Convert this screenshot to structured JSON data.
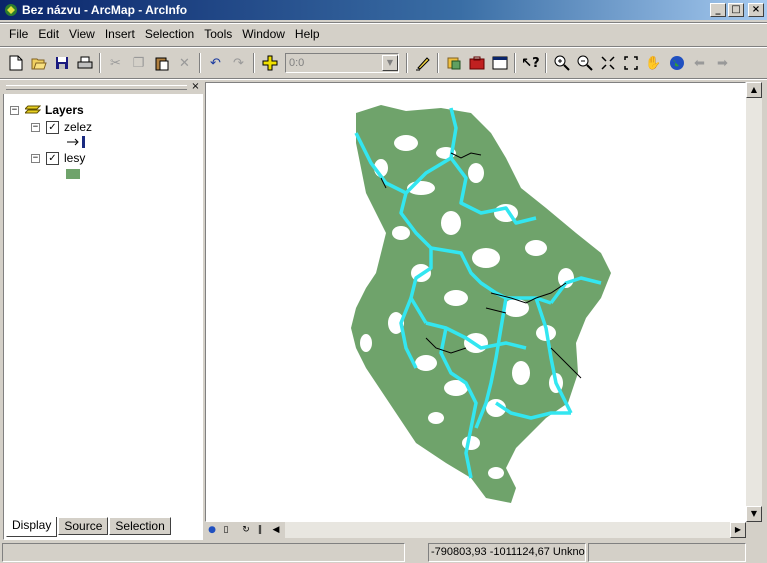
{
  "window": {
    "title": "Bez názvu - ArcMap - ArcInfo",
    "controls": {
      "minimize": "_",
      "maximize": "□",
      "close": "×"
    }
  },
  "menu": [
    {
      "label": "File",
      "key": "F"
    },
    {
      "label": "Edit",
      "key": "E"
    },
    {
      "label": "View",
      "key": "V"
    },
    {
      "label": "Insert",
      "key": "I"
    },
    {
      "label": "Selection",
      "key": "S"
    },
    {
      "label": "Tools",
      "key": "T"
    },
    {
      "label": "Window",
      "key": "W"
    },
    {
      "label": "Help",
      "key": "H"
    }
  ],
  "toolbar": {
    "scale_value": "0:0",
    "icons": [
      "new-icon",
      "open-icon",
      "save-icon",
      "print-icon",
      "cut-icon",
      "copy-icon",
      "paste-icon",
      "delete-icon",
      "undo-icon",
      "redo-icon",
      "add-data-icon",
      "scale-combo",
      "editor-icon",
      "arccatalog-icon",
      "arctoolbox-icon",
      "command-line-icon",
      "whats-this-icon",
      "zoom-in-icon",
      "zoom-out-icon",
      "fixed-zoom-in-icon",
      "fixed-zoom-out-icon",
      "pan-icon",
      "full-extent-icon",
      "back-icon",
      "forward-icon"
    ]
  },
  "toc": {
    "root_label": "Layers",
    "layers": [
      {
        "name": "zelez",
        "checked": true,
        "symbol": "line"
      },
      {
        "name": "lesy",
        "checked": true,
        "symbol": "polygon",
        "color": "#6fa36b"
      }
    ],
    "tabs": [
      "Display",
      "Source",
      "Selection"
    ],
    "active_tab": "Display"
  },
  "colors": {
    "forest": "#6fa36b",
    "river": "#33e6f0",
    "railway": "#000000"
  },
  "status": {
    "coordinates": "-790803,93  -1011124,67 Unkno"
  }
}
